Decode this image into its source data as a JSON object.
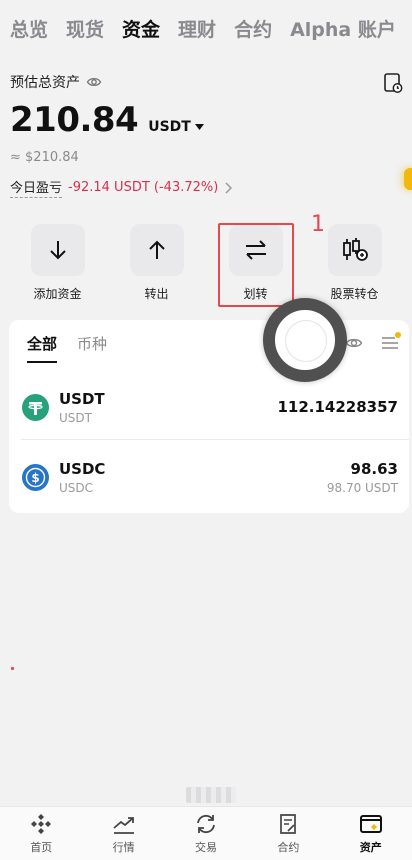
{
  "top_tabs": [
    {
      "label": "总览",
      "active": false
    },
    {
      "label": "现货",
      "active": false
    },
    {
      "label": "资金",
      "active": true
    },
    {
      "label": "理财",
      "active": false
    },
    {
      "label": "合约",
      "active": false
    },
    {
      "label": "Alpha 账户",
      "active": false
    }
  ],
  "overview": {
    "est_label": "预估总资产",
    "balance": "210.84",
    "unit": "USDT",
    "approx": "≈ $210.84",
    "pnl_label": "今日盈亏",
    "pnl_value": "-92.14 USDT (-43.72%)"
  },
  "actions": [
    {
      "label": "添加资金",
      "icon": "arrow-down-icon"
    },
    {
      "label": "转出",
      "icon": "arrow-up-icon"
    },
    {
      "label": "划转",
      "icon": "transfer-icon"
    },
    {
      "label": "股票转仓",
      "icon": "stock-transfer-icon"
    }
  ],
  "annotation": {
    "marker": "1"
  },
  "assets": {
    "tabs": [
      {
        "label": "全部",
        "active": true
      },
      {
        "label": "币种",
        "active": false
      }
    ],
    "rows": [
      {
        "symbol": "USDT",
        "name": "USDT",
        "amount": "112.14228357",
        "usd": ""
      },
      {
        "symbol": "USDC",
        "name": "USDC",
        "amount": "98.63",
        "usd": "98.70 USDT"
      }
    ]
  },
  "bottom_nav": [
    {
      "label": "首页",
      "icon": "home-icon",
      "active": false
    },
    {
      "label": "行情",
      "icon": "markets-icon",
      "active": false
    },
    {
      "label": "交易",
      "icon": "trade-icon",
      "active": false
    },
    {
      "label": "合约",
      "icon": "futures-icon",
      "active": false
    },
    {
      "label": "资产",
      "icon": "wallet-icon",
      "active": true
    }
  ],
  "colors": {
    "accent": "#f0b90b",
    "negative": "#d9304e",
    "annotation": "#e5484d",
    "usdt": "#26a17b",
    "usdc": "#2775ca"
  }
}
